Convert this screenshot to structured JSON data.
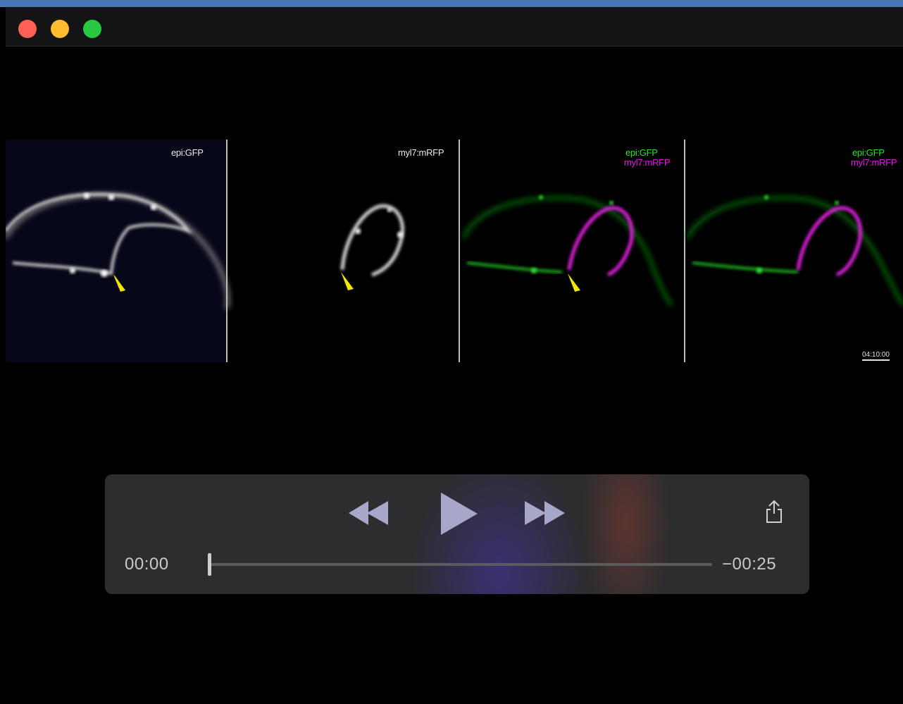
{
  "video": {
    "panels": [
      {
        "labels": [
          "epi:GFP"
        ]
      },
      {
        "labels": [
          "myl7:mRFP"
        ]
      },
      {
        "labels": [
          "epi:GFP",
          "myl7:mRFP"
        ]
      },
      {
        "labels": [
          "epi:GFP",
          "myl7:mRFP"
        ]
      }
    ],
    "timestamp": "04:10:00"
  },
  "player": {
    "elapsed": "00:00",
    "remaining": "−00:25",
    "progress": 0
  },
  "icons": {
    "rewind": "rewind-icon",
    "play": "play-icon",
    "fast_forward": "fast-forward-icon",
    "share": "share-icon"
  },
  "colors": {
    "gfp_label": "#30e030",
    "rfp_label": "#e21be2",
    "arrow": "#f2e600",
    "controls_bg": "#2d2d2f"
  }
}
